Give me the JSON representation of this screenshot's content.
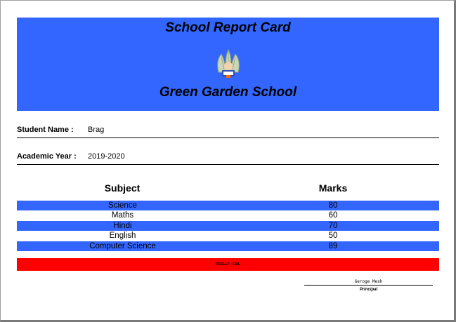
{
  "report": {
    "title": "School Report Card",
    "school_name": "Green Garden School"
  },
  "student": {
    "name_label": "Student Name :",
    "name_value": "Brag",
    "year_label": "Academic Year :",
    "year_value": "2019-2020"
  },
  "table": {
    "subject_header": "Subject",
    "marks_header": "Marks",
    "rows": [
      {
        "subject": "Science",
        "marks": "80"
      },
      {
        "subject": "Maths",
        "marks": "60"
      },
      {
        "subject": "Hindi",
        "marks": "70"
      },
      {
        "subject": "English",
        "marks": "50"
      },
      {
        "subject": "Computer Science",
        "marks": "89"
      }
    ]
  },
  "result": {
    "text": "RESULT : FAIL"
  },
  "signature": {
    "name": "Geroge Mesh",
    "title": "Principal"
  },
  "colors": {
    "header_bg": "#3366ff",
    "row_shade": "#3366ff",
    "result_bg": "#ff0000"
  },
  "icons": {
    "logo": "school-logo-icon"
  }
}
